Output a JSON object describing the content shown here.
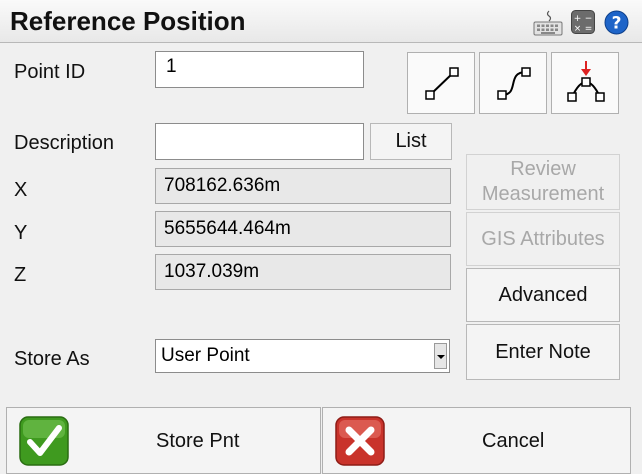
{
  "header": {
    "title": "Reference Position",
    "icons": [
      "keyboard-icon",
      "calculator-icon",
      "help-icon"
    ]
  },
  "form": {
    "point_id_label": "Point ID",
    "point_id_value": "1",
    "description_label": "Description",
    "description_value": "",
    "list_button": "List",
    "x_label": "X",
    "x_value": "708162.636m",
    "y_label": "Y",
    "y_value": "5655644.464m",
    "z_label": "Z",
    "z_value": "1037.039m",
    "store_as_label": "Store As",
    "store_as_value": "User Point"
  },
  "actions": {
    "review_line1": "Review",
    "review_line2": "Measurement",
    "gis_attributes": "GIS Attributes",
    "advanced": "Advanced",
    "enter_note": "Enter Note"
  },
  "footer": {
    "store_label": "Store Pnt",
    "cancel_label": "Cancel"
  },
  "colors": {
    "check_green": "#3f9a1f",
    "cancel_red": "#c9332b",
    "help_blue": "#1e64c8",
    "arrow_red": "#dd2222"
  }
}
